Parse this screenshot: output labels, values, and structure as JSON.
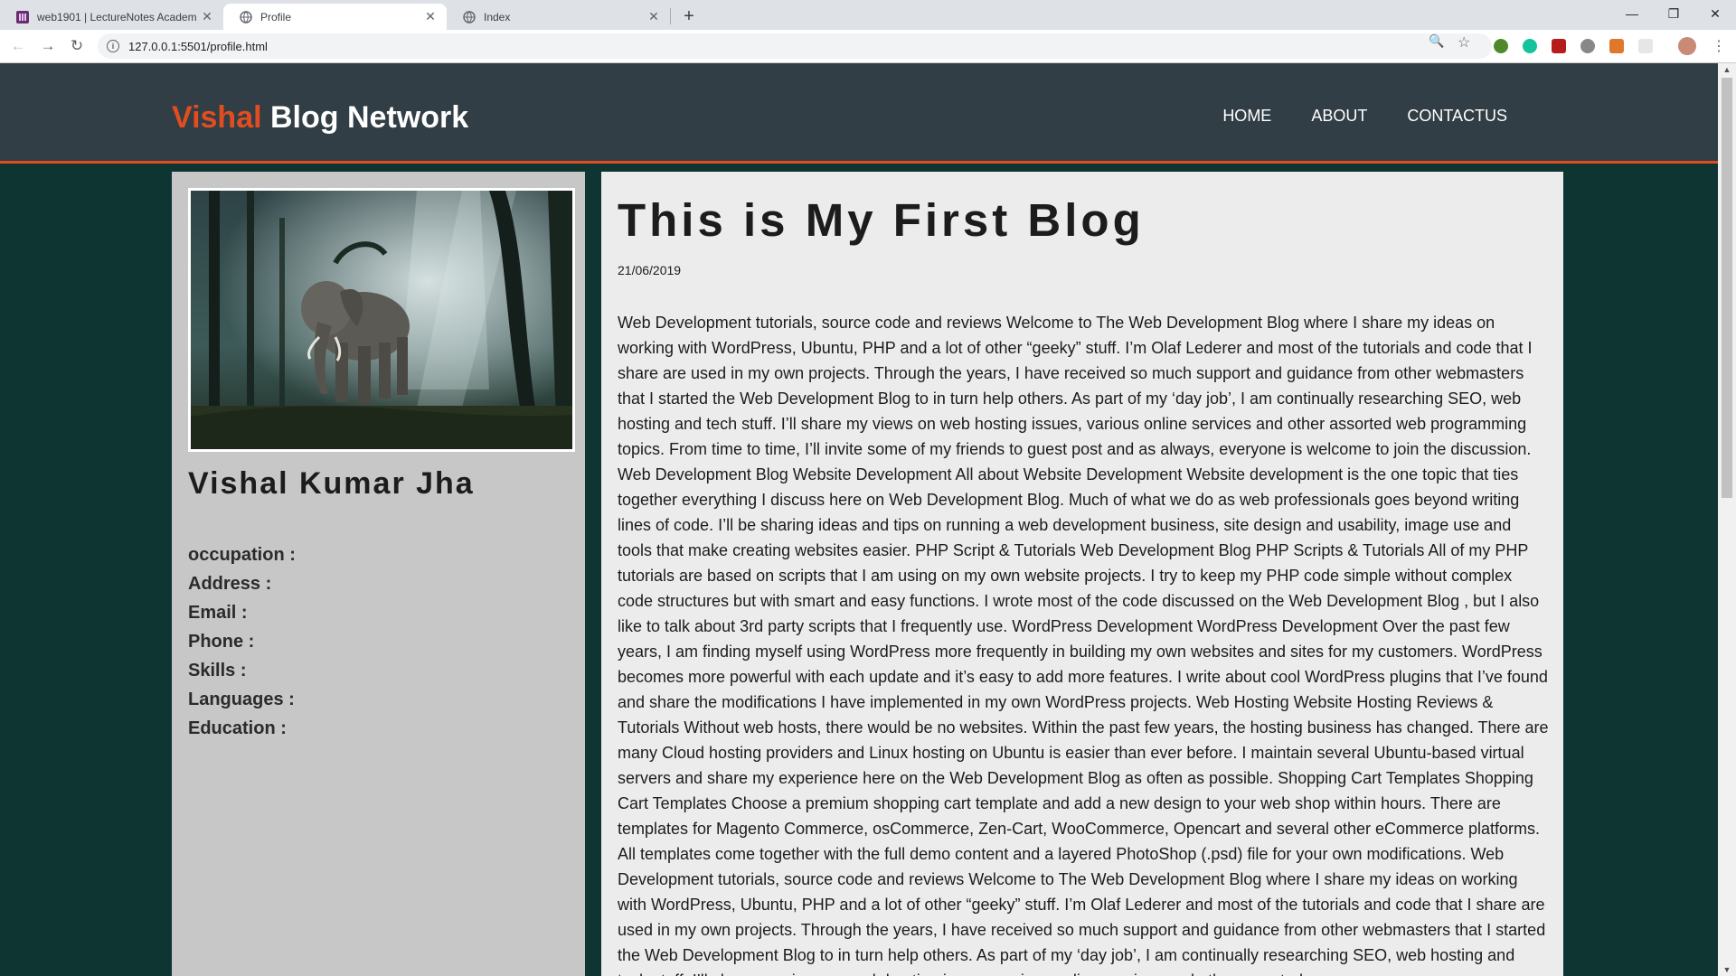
{
  "browser": {
    "tabs": [
      {
        "title": "web1901 | LectureNotes Academ",
        "active": false
      },
      {
        "title": "Profile",
        "active": true
      },
      {
        "title": "Index",
        "active": false
      }
    ],
    "url": "127.0.0.1:5501/profile.html"
  },
  "site": {
    "brand_first": "Vishal",
    "brand_rest": "Blog Network",
    "nav": [
      "HOME",
      "ABOUT",
      "CONTACTUS"
    ],
    "colors": {
      "accent": "#e24d1f",
      "header_bg": "#323e45",
      "page_bg": "#0e3532"
    }
  },
  "profile": {
    "name": "Vishal Kumar Jha",
    "fields": [
      "occupation :",
      "Address :",
      "Email :",
      "Phone :",
      "Skills :",
      "Languages :",
      "Education :"
    ]
  },
  "blog": {
    "title": "This is My First Blog",
    "date": "21/06/2019",
    "body": "Web Development tutorials, source code and reviews Welcome to The Web Development Blog where I share my ideas on working with WordPress, Ubuntu, PHP and a lot of other “geeky” stuff. I’m Olaf Lederer and most of the tutorials and code that I share are used in my own projects. Through the years, I have received so much support and guidance from other webmasters that I started the Web Development Blog to in turn help others. As part of my ‘day job’, I am continually researching SEO, web hosting and tech stuff. I’ll share my views on web hosting issues, various online services and other assorted web programming topics. From time to time, I’ll invite some of my friends to guest post and as always, everyone is welcome to join the discussion. Web Development Blog Website Development All about Website Development Website development is the one topic that ties together everything I discuss here on Web Development Blog. Much of what we do as web professionals goes beyond writing lines of code. I’ll be sharing ideas and tips on running a web development business, site design and usability, image use and tools that make creating websites easier. PHP Script & Tutorials Web Development Blog PHP Scripts & Tutorials All of my PHP tutorials are based on scripts that I am using on my own website projects. I try to keep my PHP code simple without complex code structures but with smart and easy functions. I wrote most of the code discussed on the Web Development Blog , but I also like to talk about 3rd party scripts that I frequently use. WordPress Development WordPress Development Over the past few years, I am finding myself using WordPress more frequently in building my own websites and sites for my customers. WordPress becomes more powerful with each update and it’s easy to add more features. I write about cool WordPress plugins that I’ve found and share the modifications I have implemented in my own WordPress projects. Web Hosting Website Hosting Reviews & Tutorials Without web hosts, there would be no websites. Within the past few years, the hosting business has changed. There are many Cloud hosting providers and Linux hosting on Ubuntu is easier than ever before. I maintain several Ubuntu-based virtual servers and share my experience here on the Web Development Blog as often as possible. Shopping Cart Templates Shopping Cart Templates Choose a premium shopping cart template and add a new design to your web shop within hours. There are templates for Magento Commerce, osCommerce, Zen-Cart, WooCommerce, Opencart and several other eCommerce platforms. All templates come together with the full demo content and a layered PhotoShop (.psd) file for your own modifications. Web Development tutorials, source code and reviews Welcome to The Web Development Blog where I share my ideas on working with WordPress, Ubuntu, PHP and a lot of other “geeky” stuff. I’m Olaf Lederer and most of the tutorials and code that I share are used in my own projects. Through the years, I have received so much support and guidance from other webmasters that I started the Web Development Blog to in turn help others. As part of my ‘day job’, I am continually researching SEO, web hosting and tech stuff. I’ll share my views on web hosting issues, various online services and other assorted"
  }
}
